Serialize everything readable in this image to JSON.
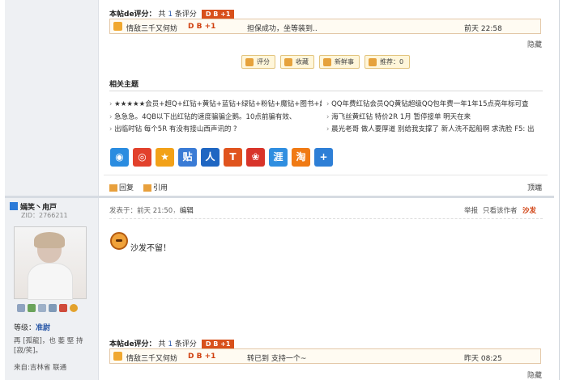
{
  "rating_top": {
    "label": "本帖de评分：",
    "prefix": "共",
    "count": "1",
    "suffix": "条评分",
    "badge": "D B +1",
    "row": {
      "user": "情敌三千又何妨",
      "score": "D B +1",
      "comment": "担保成功，坐等装到..",
      "time": "前天 22:58"
    },
    "hide": "隐藏"
  },
  "actions": {
    "rate": "评分",
    "collect": "收藏",
    "news": "新鲜事",
    "recommend": "推荐：0"
  },
  "related": {
    "title": "相关主题",
    "items": [
      "★★★★★会员+超Q+红钻+黄钻+蓝钻+绿钻+粉钻+魔钻+图书+超",
      "QQ年费红钻会员QQ黄钻超级QQ包年费一年1年15点亮年标可査",
      "急急急。4QB以下出红钻的速度骗骗企鹅。10点前骗有效、",
      "海飞丝黄红钻 特价2R 1月  暂停接单 明天在来",
      "出临时钻 每个5R 有没有接山西声讯的 ?",
      "晨光老哥 做人要厚道 别给我支撑了 新人洗不起船啊 求洗脸 F5: 出"
    ]
  },
  "share_icons": [
    {
      "name": "qzone",
      "glyph": "◉",
      "color": "#2a8ce0"
    },
    {
      "name": "weibo",
      "glyph": "◎",
      "color": "#e2412c"
    },
    {
      "name": "favorite",
      "glyph": "★",
      "color": "#f2a118"
    },
    {
      "name": "tieba",
      "glyph": "贴",
      "color": "#3a7bd5"
    },
    {
      "name": "renren",
      "glyph": "人",
      "color": "#1f66c2"
    },
    {
      "name": "kaixin",
      "glyph": "T",
      "color": "#e0541e"
    },
    {
      "name": "douban",
      "glyph": "❀",
      "color": "#d8342a"
    },
    {
      "name": "huijia",
      "glyph": "涯",
      "color": "#2f8ee0"
    },
    {
      "name": "taobao",
      "glyph": "淘",
      "color": "#f07a14"
    },
    {
      "name": "more",
      "glyph": "+",
      "color": "#2e7fd6"
    }
  ],
  "reply_row": {
    "reply": "回复",
    "quote": "引用",
    "top": "顶端"
  },
  "user": {
    "name": "嫣笑丶甪戸",
    "zid": "ZID：2766211",
    "level_label": "等级：",
    "level": "准尉",
    "signature": "再 [孤龍]，也 萎 堅 持 [寂/笑]。",
    "location": "来自:吉林省 联通"
  },
  "post": {
    "posted": "发表于：前天 21:50",
    "sep": "，",
    "edit": "编辑",
    "report": "举报",
    "only_author": "只看该作者",
    "sofa": "沙发",
    "text": "沙发不留！"
  },
  "rating_bottom": {
    "label": "本帖de评分：",
    "prefix": "共",
    "count": "1",
    "suffix": "条评分",
    "badge": "D B +1",
    "row": {
      "user": "情敌三千又何妨",
      "score": "D B +1",
      "comment": "转已到   支持一个~",
      "time": "昨天 08:25"
    },
    "hide": "隐藏"
  }
}
